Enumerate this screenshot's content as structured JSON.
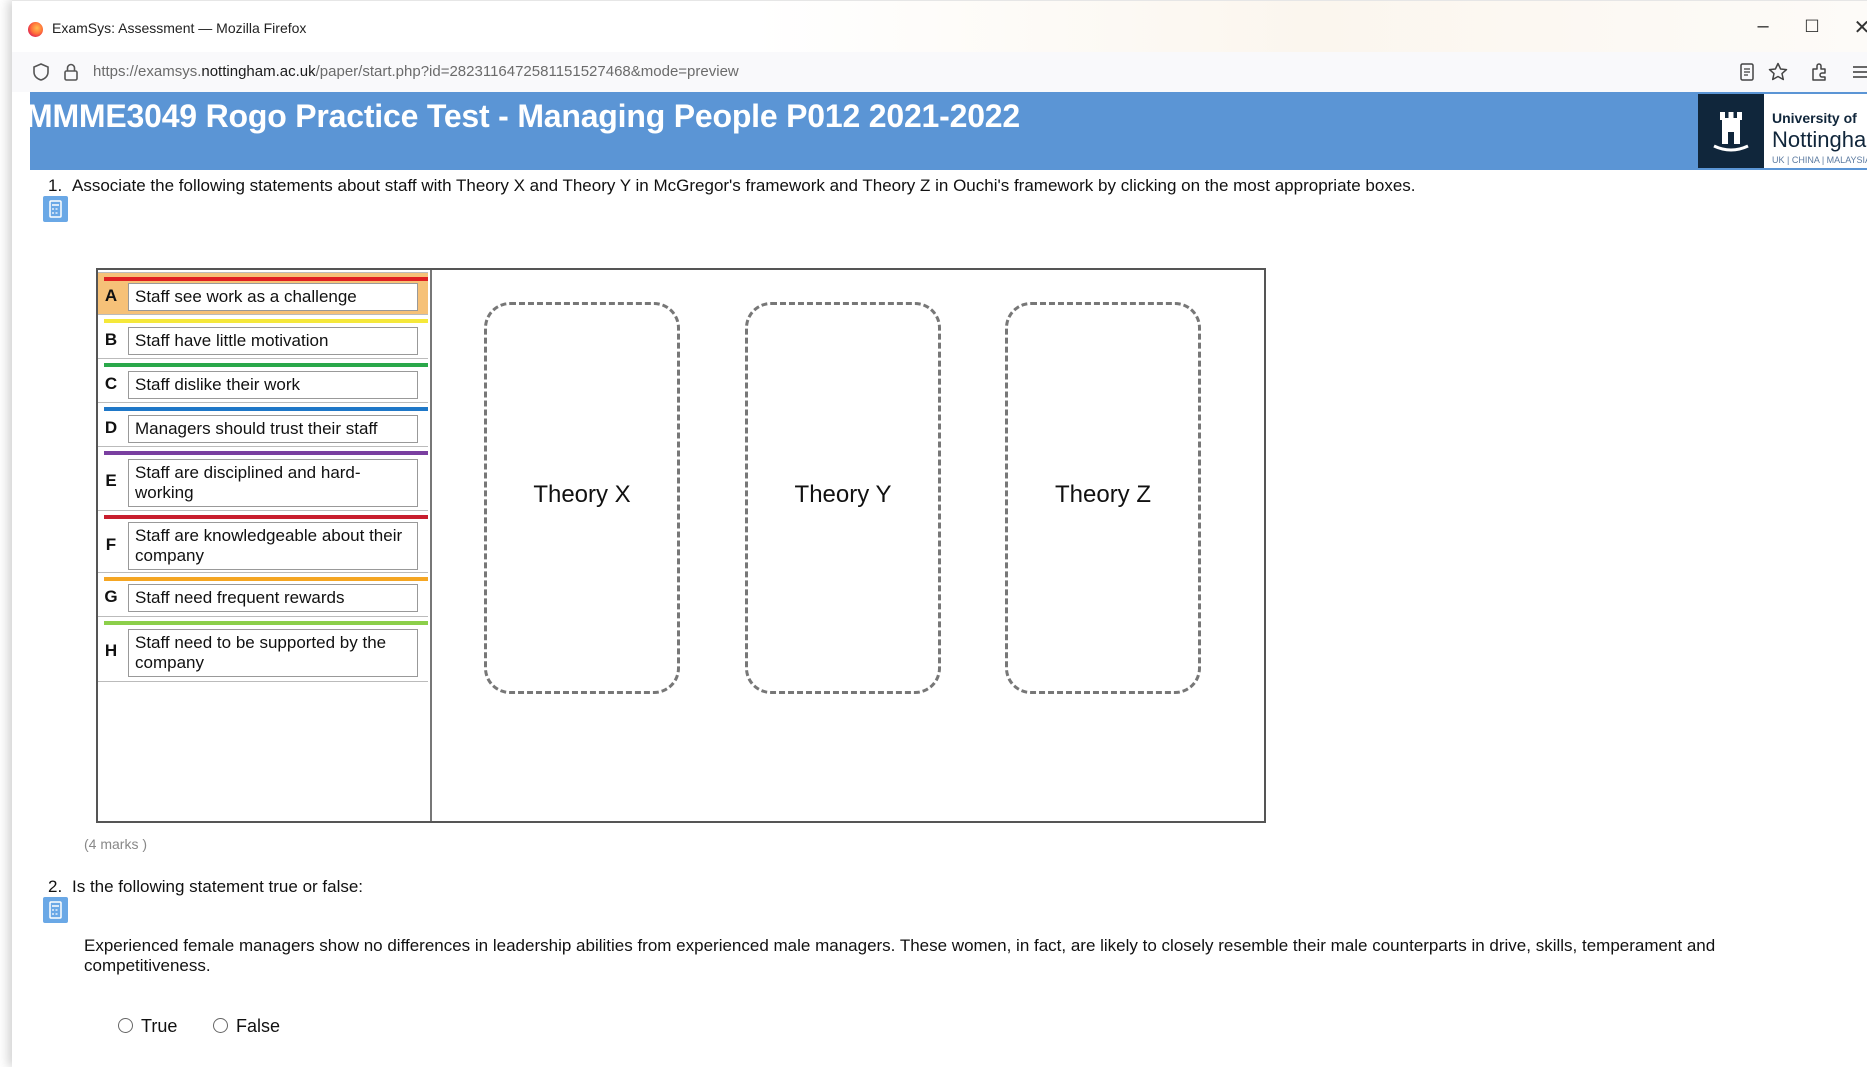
{
  "window": {
    "title": "ExamSys: Assessment — Mozilla Firefox",
    "controls": {
      "minimize": "–",
      "maximize": "☐",
      "close": "✕"
    }
  },
  "urlbar": {
    "url_prefix": "https://examsys.",
    "url_domain": "nottingham.ac.uk",
    "url_path": "/paper/start.php?id=2823116472581151527468&mode=preview"
  },
  "header": {
    "title": "MMME3049 Rogo Practice Test - Managing People P012 2021-2022",
    "logo": {
      "line1": "University of",
      "line2": "Nottingham",
      "line3": "UK | CHINA | MALAYSIA"
    }
  },
  "question1": {
    "number": "1.",
    "text": "Associate the following statements about staff with Theory X and Theory Y in McGregor's framework and Theory Z in Ouchi's framework by clicking on the most appropriate boxes.",
    "items": [
      {
        "letter": "A",
        "text": "Staff see work as a challenge",
        "color": "#e02020"
      },
      {
        "letter": "B",
        "text": "Staff have little motivation",
        "color": "#f5e83a"
      },
      {
        "letter": "C",
        "text": "Staff dislike their work",
        "color": "#2aa84a"
      },
      {
        "letter": "D",
        "text": "Managers should trust their staff",
        "color": "#1f78c8"
      },
      {
        "letter": "E",
        "text": "Staff are disciplined and hard-working",
        "color": "#7a3fa0"
      },
      {
        "letter": "F",
        "text": "Staff are knowledgeable about their company",
        "color": "#c81e2e"
      },
      {
        "letter": "G",
        "text": "Staff need frequent rewards",
        "color": "#f5a623"
      },
      {
        "letter": "H",
        "text": "Staff need to be supported by the company",
        "color": "#8ccf4a"
      }
    ],
    "targets": [
      "Theory X",
      "Theory Y",
      "Theory Z"
    ],
    "marks": "(4 marks )"
  },
  "question2": {
    "number": "2.",
    "text": "Is the following statement true or false:",
    "statement": "Experienced female managers show no differences in leadership abilities from experienced male managers. These women, in fact, are likely to closely resemble their male counterparts in drive, skills, temperament and competitiveness.",
    "options": [
      "True",
      "False"
    ]
  }
}
